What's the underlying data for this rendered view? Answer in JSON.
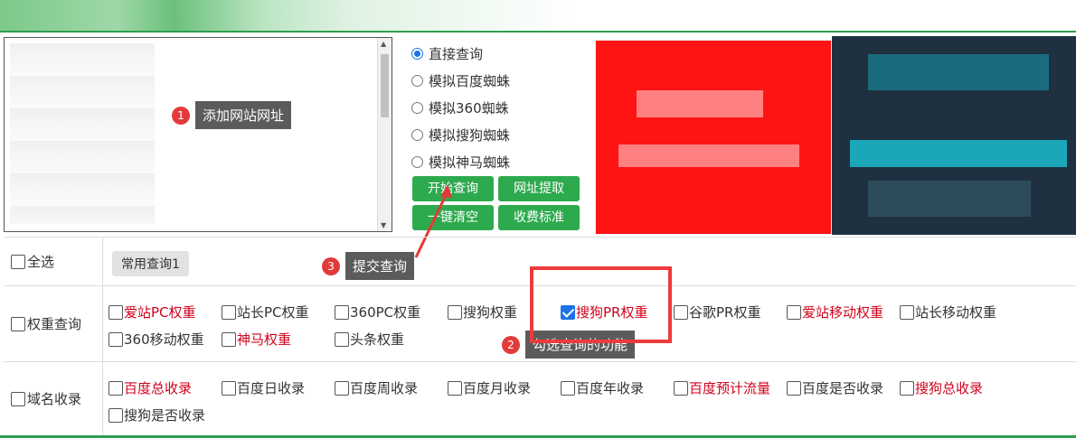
{
  "url_input": {
    "annotation_number": "1",
    "annotation_text": "添加网站网址"
  },
  "query_modes": [
    {
      "label": "直接查询",
      "selected": true
    },
    {
      "label": "模拟百度蜘蛛",
      "selected": false
    },
    {
      "label": "模拟360蜘蛛",
      "selected": false
    },
    {
      "label": "模拟搜狗蜘蛛",
      "selected": false
    },
    {
      "label": "模拟神马蜘蛛",
      "selected": false
    }
  ],
  "buttons": {
    "start_query": "开始查询",
    "url_extract": "网址提取",
    "clear_all": "一键清空",
    "fee_standard": "收费标准"
  },
  "submit_annotation": {
    "number": "3",
    "text": "提交查询"
  },
  "check_annotation": {
    "number": "2",
    "text": "勾选查询的功能"
  },
  "select_all": {
    "label": "全选",
    "preset": "常用查询1"
  },
  "weight_section": {
    "title": "权重查询",
    "items": [
      {
        "label": "爱站PC权重",
        "red": true,
        "checked": false
      },
      {
        "label": "站长PC权重",
        "red": false,
        "checked": false
      },
      {
        "label": "360PC权重",
        "red": false,
        "checked": false
      },
      {
        "label": "搜狗权重",
        "red": false,
        "checked": false
      },
      {
        "label": "搜狗PR权重",
        "red": true,
        "checked": true
      },
      {
        "label": "谷歌PR权重",
        "red": false,
        "checked": false
      },
      {
        "label": "爱站移动权重",
        "red": true,
        "checked": false
      },
      {
        "label": "站长移动权重",
        "red": false,
        "checked": false
      },
      {
        "label": "360移动权重",
        "red": false,
        "checked": false
      },
      {
        "label": "神马权重",
        "red": true,
        "checked": false
      },
      {
        "label": "头条权重",
        "red": false,
        "checked": false
      }
    ]
  },
  "index_section": {
    "title": "域名收录",
    "items": [
      {
        "label": "百度总收录",
        "red": true,
        "checked": false
      },
      {
        "label": "百度日收录",
        "red": false,
        "checked": false
      },
      {
        "label": "百度周收录",
        "red": false,
        "checked": false
      },
      {
        "label": "百度月收录",
        "red": false,
        "checked": false
      },
      {
        "label": "百度年收录",
        "red": false,
        "checked": false
      },
      {
        "label": "百度预计流量",
        "red": true,
        "checked": false
      },
      {
        "label": "百度是否收录",
        "red": false,
        "checked": false
      },
      {
        "label": "搜狗总收录",
        "red": true,
        "checked": false
      },
      {
        "label": "搜狗是否收录",
        "red": false,
        "checked": false
      }
    ]
  },
  "colors": {
    "accent_green": "#2eaa4e",
    "highlight_red": "#ee3b3b",
    "label_red": "#d0021b"
  }
}
